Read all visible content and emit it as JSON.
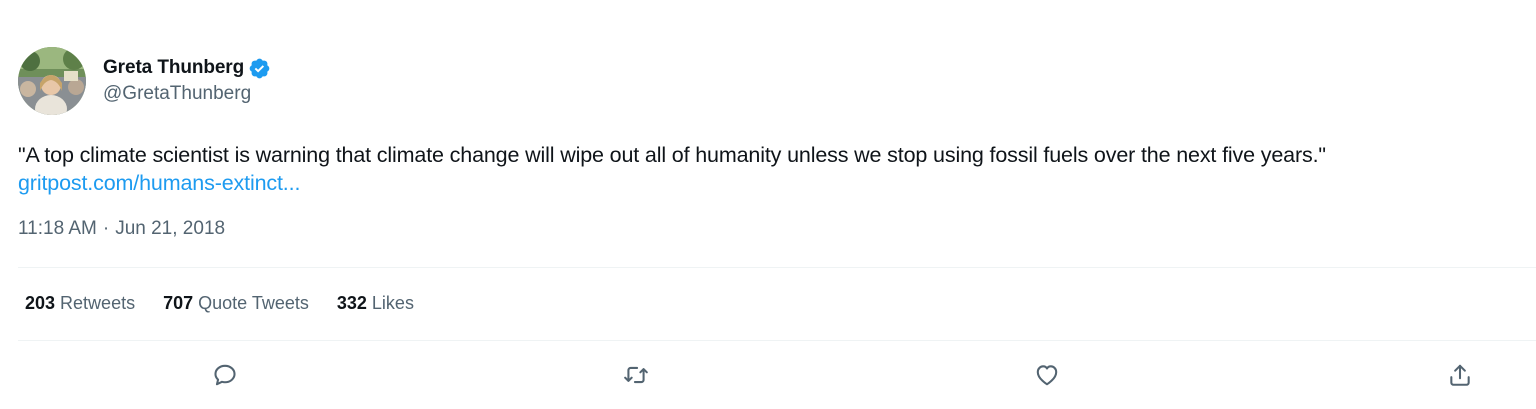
{
  "author": {
    "name": "Greta Thunberg",
    "handle": "@GretaThunberg",
    "verified": true
  },
  "tweet": {
    "text": "\"A top climate scientist is warning that climate change will wipe out all of humanity unless we stop using fossil fuels over the next five years.\"",
    "link": "gritpost.com/humans-extinct...",
    "time": "11:18 AM",
    "separator": "·",
    "date": "Jun 21, 2018"
  },
  "stats": {
    "retweets": {
      "count": "203",
      "label": "Retweets"
    },
    "quote_tweets": {
      "count": "707",
      "label": "Quote Tweets"
    },
    "likes": {
      "count": "332",
      "label": "Likes"
    }
  },
  "actions": [
    "reply-icon",
    "retweet-icon",
    "like-icon",
    "share-icon"
  ],
  "colors": {
    "link": "#1d9bf0",
    "verified": "#1d9bf0",
    "secondary_text": "#536471",
    "divider": "#eff3f4"
  }
}
